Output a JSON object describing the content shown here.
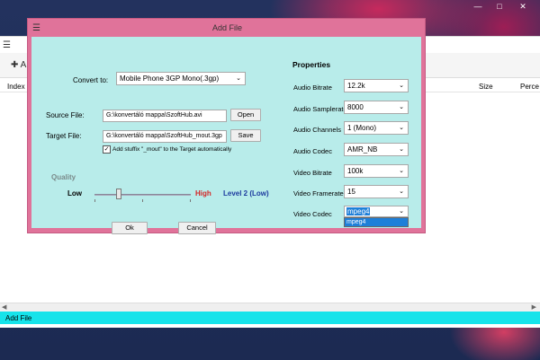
{
  "main": {
    "toolbar": {
      "add_label": "A"
    },
    "columns": {
      "index": "Index",
      "size": "Size",
      "perce": "Perce"
    },
    "status": "Add File"
  },
  "dialog": {
    "title": "Add File",
    "convert_to": {
      "label": "Convert to:",
      "value": "Mobile Phone 3GP Mono(.3gp)"
    },
    "source": {
      "label": "Source File:",
      "value": "G:\\konvertáló mappa\\SzoftHub.avi",
      "button": "Open"
    },
    "target": {
      "label": "Target File:",
      "value": "G:\\konvertáló mappa\\SzoftHub_mout.3gp",
      "button": "Save"
    },
    "add_stuffix": {
      "label": "Add stuffix \"_mout\" to the Target automatically",
      "checked": true
    },
    "quality": {
      "label": "Quality",
      "low": "Low",
      "high": "High",
      "level": "Level 2 (Low)",
      "position": 0.25
    },
    "ok": "Ok",
    "cancel": "Cancel",
    "properties": {
      "title": "Properties",
      "items": [
        {
          "label": "Audio Bitrate",
          "value": "12.2k"
        },
        {
          "label": "Audio Samplerate",
          "value": "8000"
        },
        {
          "label": "Audio Channels",
          "value": "1 (Mono)"
        },
        {
          "label": "Audio Codec",
          "value": "AMR_NB"
        },
        {
          "label": "Video Bitrate",
          "value": "100k"
        },
        {
          "label": "Video Framerate",
          "value": "15"
        },
        {
          "label": "Video Codec",
          "value": "mpeg4"
        }
      ],
      "video_codec_options": [
        "mpeg4"
      ]
    }
  },
  "colors": {
    "dialog_frame": "#e0739a",
    "dialog_body": "#b8ecea",
    "status_bar": "#16e3ea",
    "high_text": "#d42626",
    "level_text": "#1c3a9e",
    "selection": "#1e7fd8"
  }
}
